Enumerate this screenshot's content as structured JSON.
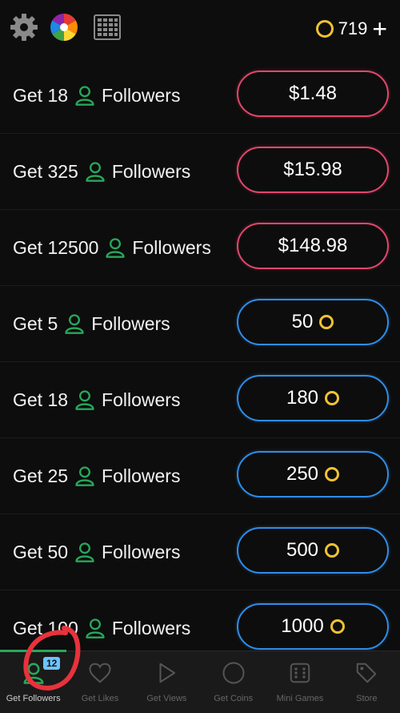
{
  "header": {
    "coins": "719",
    "icons": [
      "gear-icon",
      "color-wheel-icon",
      "grid-icon",
      "coin-icon",
      "plus-icon"
    ]
  },
  "rows": [
    {
      "pre": "Get 18",
      "post": "Followers",
      "price": "$1.48",
      "kind": "money"
    },
    {
      "pre": "Get 325",
      "post": "Followers",
      "price": "$15.98",
      "kind": "money"
    },
    {
      "pre": "Get 12500",
      "post": "Followers",
      "price": "$148.98",
      "kind": "money"
    },
    {
      "pre": "Get 5",
      "post": "Followers",
      "price": "50",
      "kind": "coin"
    },
    {
      "pre": "Get 18",
      "post": "Followers",
      "price": "180",
      "kind": "coin"
    },
    {
      "pre": "Get 25",
      "post": "Followers",
      "price": "250",
      "kind": "coin"
    },
    {
      "pre": "Get 50",
      "post": "Followers",
      "price": "500",
      "kind": "coin"
    },
    {
      "pre": "Get 100",
      "post": "Followers",
      "price": "1000",
      "kind": "coin"
    }
  ],
  "tabs": [
    {
      "label": "Get Followers",
      "icon": "person-icon",
      "active": true,
      "badge": "12"
    },
    {
      "label": "Get Likes",
      "icon": "heart-icon"
    },
    {
      "label": "Get Views",
      "icon": "play-icon"
    },
    {
      "label": "Get Coins",
      "icon": "coin-icon"
    },
    {
      "label": "Mini Games",
      "icon": "dice-icon"
    },
    {
      "label": "Store",
      "icon": "tag-icon"
    }
  ],
  "colors": {
    "accent_green": "#27a85a",
    "money_border": "#e2466c",
    "coin_border": "#2f8de8",
    "coin_gold": "#f1c232",
    "annotation_red": "#e8323c"
  }
}
